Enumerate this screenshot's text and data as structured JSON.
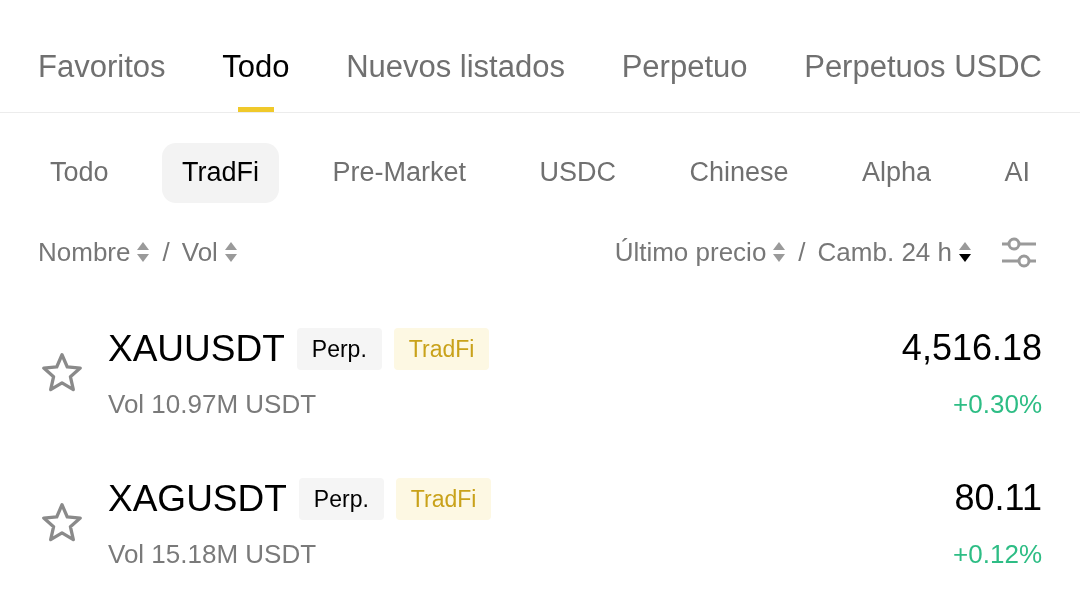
{
  "tabs": [
    {
      "label": "Favoritos",
      "selected": false
    },
    {
      "label": "Todo",
      "selected": true
    },
    {
      "label": "Nuevos listados",
      "selected": false
    },
    {
      "label": "Perpetuo",
      "selected": false
    },
    {
      "label": "Perpetuos USDC",
      "selected": false
    }
  ],
  "chips": [
    {
      "label": "Todo",
      "selected": false
    },
    {
      "label": "TradFi",
      "selected": true
    },
    {
      "label": "Pre-Market",
      "selected": false
    },
    {
      "label": "USDC",
      "selected": false
    },
    {
      "label": "Chinese",
      "selected": false
    },
    {
      "label": "Alpha",
      "selected": false
    },
    {
      "label": "AI",
      "selected": false
    }
  ],
  "header": {
    "left": [
      {
        "label": "Nombre",
        "sorted_asc": false,
        "sorted_desc": false
      },
      {
        "label": "Vol",
        "sorted_asc": false,
        "sorted_desc": false
      }
    ],
    "right": [
      {
        "label": "Último precio",
        "sorted_asc": false,
        "sorted_desc": false
      },
      {
        "label": "Camb. 24 h",
        "sorted_asc": false,
        "sorted_desc": true
      }
    ],
    "separator": "/"
  },
  "rows": [
    {
      "symbol": "XAUUSDT",
      "favorite": false,
      "tags": [
        {
          "label": "Perp.",
          "kind": "plain"
        },
        {
          "label": "TradFi",
          "kind": "tradfi"
        }
      ],
      "volume": "Vol 10.97M USDT",
      "price": "4,516.18",
      "change": "+0.30%",
      "positive": true
    },
    {
      "symbol": "XAGUSDT",
      "favorite": false,
      "tags": [
        {
          "label": "Perp.",
          "kind": "plain"
        },
        {
          "label": "TradFi",
          "kind": "tradfi"
        }
      ],
      "volume": "Vol 15.18M USDT",
      "price": "80.11",
      "change": "+0.12%",
      "positive": true
    }
  ]
}
